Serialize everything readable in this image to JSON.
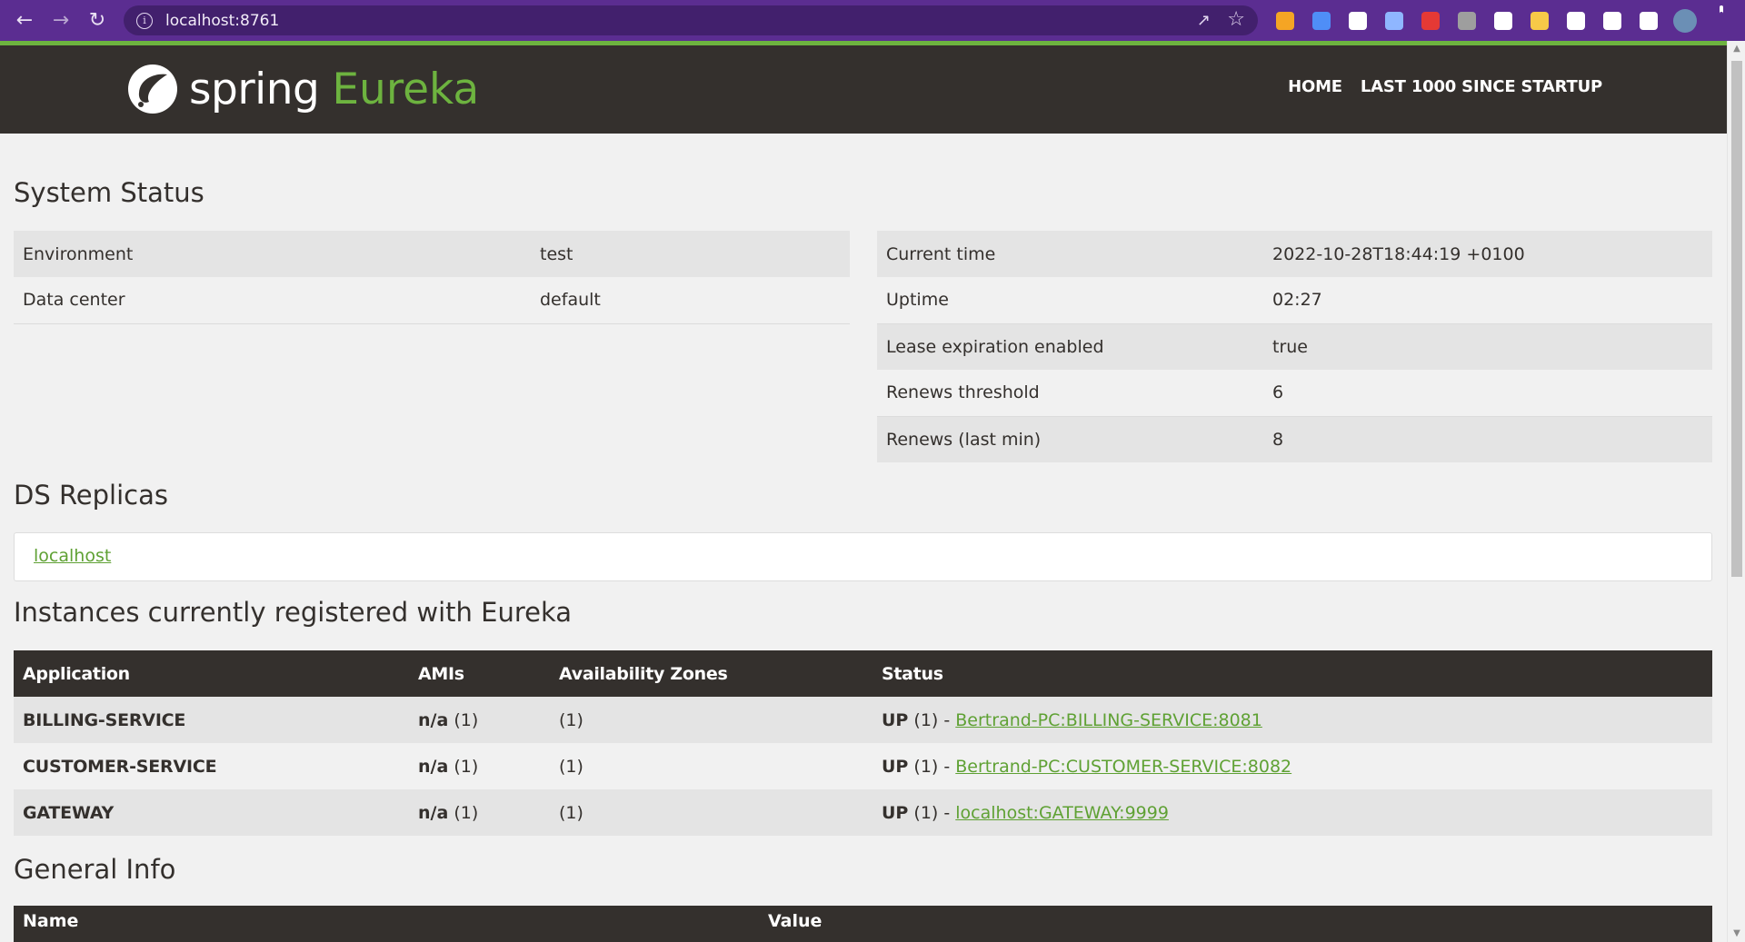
{
  "browser": {
    "url": "localhost:8761",
    "back_icon": "arrow-left-icon",
    "forward_icon": "arrow-right-icon",
    "reload_icon": "reload-icon",
    "extensions": [
      {
        "name": "pen-extension-icon",
        "color": "#f5a524"
      },
      {
        "name": "translate-extension-icon",
        "color": "#4f8ef7"
      },
      {
        "name": "circle-extension-icon",
        "color": "#ffffff"
      },
      {
        "name": "screen-extension-icon",
        "color": "#8fb6ff"
      },
      {
        "name": "red-drop-extension-icon",
        "color": "#e53935"
      },
      {
        "name": "plus-extension-icon",
        "color": "#9e9e9e"
      },
      {
        "name": "b-extension-icon",
        "color": "#ffffff"
      },
      {
        "name": "color-extension-icon",
        "color": "#f7c948"
      },
      {
        "name": "puzzle-icon",
        "color": "#ffffff"
      },
      {
        "name": "playlist-icon",
        "color": "#ffffff"
      },
      {
        "name": "sidepanel-icon",
        "color": "#ffffff"
      },
      {
        "name": "profile-avatar",
        "color": "#6b8fb5"
      },
      {
        "name": "more-icon",
        "color": "#ffffff"
      }
    ]
  },
  "header": {
    "brand": "spring",
    "product": "Eureka",
    "nav": [
      "HOME",
      "LAST 1000 SINCE STARTUP"
    ]
  },
  "system_status": {
    "title": "System Status",
    "left": [
      {
        "label": "Environment",
        "value": "test"
      },
      {
        "label": "Data center",
        "value": "default"
      }
    ],
    "right": [
      {
        "label": "Current time",
        "value": "2022-10-28T18:44:19 +0100"
      },
      {
        "label": "Uptime",
        "value": "02:27"
      },
      {
        "label": "Lease expiration enabled",
        "value": "true"
      },
      {
        "label": "Renews threshold",
        "value": "6"
      },
      {
        "label": "Renews (last min)",
        "value": "8"
      }
    ]
  },
  "ds_replicas": {
    "title": "DS Replicas",
    "link": "localhost"
  },
  "instances": {
    "title": "Instances currently registered with Eureka",
    "columns": [
      "Application",
      "AMIs",
      "Availability Zones",
      "Status"
    ],
    "rows": [
      {
        "app": "BILLING-SERVICE",
        "amis_label": "n/a",
        "amis_count": "(1)",
        "zones": "(1)",
        "status": "UP",
        "status_count": "(1) -",
        "instance": "Bertrand-PC:BILLING-SERVICE:8081"
      },
      {
        "app": "CUSTOMER-SERVICE",
        "amis_label": "n/a",
        "amis_count": "(1)",
        "zones": "(1)",
        "status": "UP",
        "status_count": "(1) -",
        "instance": "Bertrand-PC:CUSTOMER-SERVICE:8082"
      },
      {
        "app": "GATEWAY",
        "amis_label": "n/a",
        "amis_count": "(1)",
        "zones": "(1)",
        "status": "UP",
        "status_count": "(1) -",
        "instance": "localhost:GATEWAY:9999"
      }
    ]
  },
  "general_info": {
    "title": "General Info",
    "columns": [
      "Name",
      "Value"
    ]
  }
}
